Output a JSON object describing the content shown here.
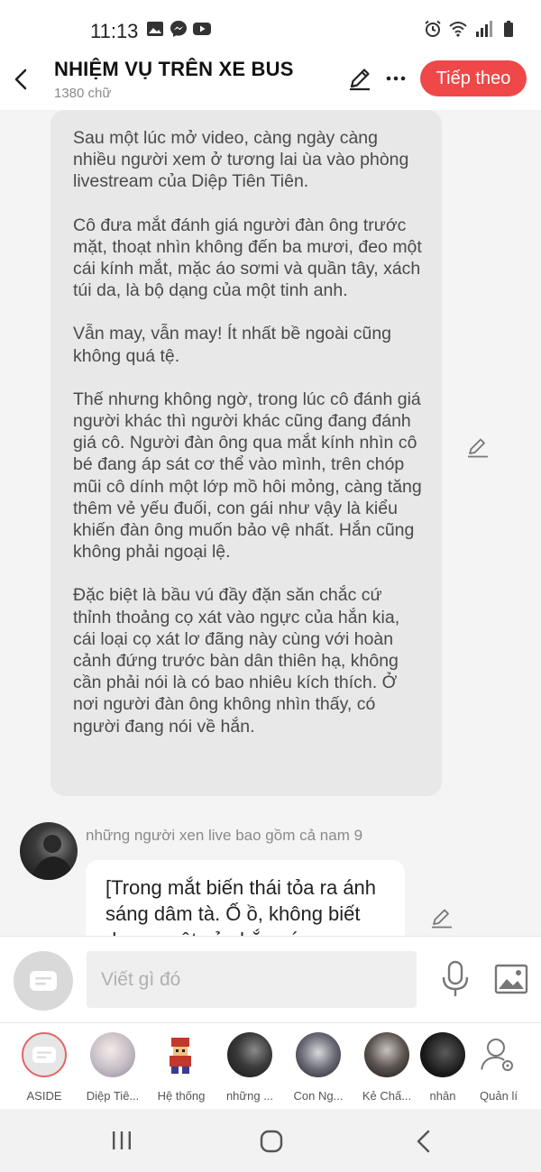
{
  "status_bar": {
    "time": "11:13",
    "left_icons": [
      "image-icon",
      "messenger-icon",
      "youtube-icon"
    ],
    "right_icons": [
      "alarm-icon",
      "wifi-icon",
      "signal-icon",
      "battery-icon"
    ]
  },
  "header": {
    "title": "NHIỆM VỤ TRÊN XE BUS",
    "subtitle": "1380 chữ",
    "next_label": "Tiếp theo",
    "accent_color": "#f04848"
  },
  "narration": {
    "paragraphs": [
      "Sau một lúc mở video, càng ngày càng nhiều người xem ở tương lai ùa vào phòng livestream của Diệp Tiên Tiên.",
      "Cô đưa mắt đánh giá người đàn ông trước mặt, thoạt nhìn không đến ba mươi, đeo một cái kính mắt, mặc áo sơmi và quần tây, xách túi da, là bộ dạng của một tinh anh.",
      "Vẫn may, vẫn may! Ít nhất bề ngoài cũng không quá tệ.",
      "Thế nhưng không ngờ, trong lúc cô đánh giá người khác thì người khác cũng đang đánh giá cô. Người đàn ông qua mắt kính nhìn cô bé đang áp sát cơ thể vào mình, trên chóp mũi cô dính một lớp mồ hôi mỏng, càng tăng thêm vẻ yếu đuối, con gái như vậy là kiểu khiến đàn ông muốn bảo vệ nhất. Hắn cũng không phải ngoại lệ.",
      "Đặc biệt là bầu vú đầy đặn săn chắc cứ thỉnh thoảng cọ xát vào ngực của hắn kia, cái loại cọ xát lơ đãng này cùng với hoàn cảnh đứng trước bàn dân thiên hạ, không cần phải nói là có bao nhiêu kích thích. Ở nơi người đàn ông không nhìn thấy, có người đang nói về hắn."
    ]
  },
  "message": {
    "sender": "những người xen live bao gồm cả nam 9",
    "text": "[Trong mắt biến thái tỏa ra ánh sáng dâm tà. Ố ồ, không biết dương vật của hắn có"
  },
  "composer": {
    "placeholder": "Viết gì đó"
  },
  "characters": [
    {
      "label": "ASIDE"
    },
    {
      "label": "Diệp Tiê..."
    },
    {
      "label": "Hệ thống"
    },
    {
      "label": "những ..."
    },
    {
      "label": "Con Ng..."
    },
    {
      "label": "Kẻ Chấ..."
    },
    {
      "label": "nhân"
    },
    {
      "label": "Quản lí"
    }
  ]
}
